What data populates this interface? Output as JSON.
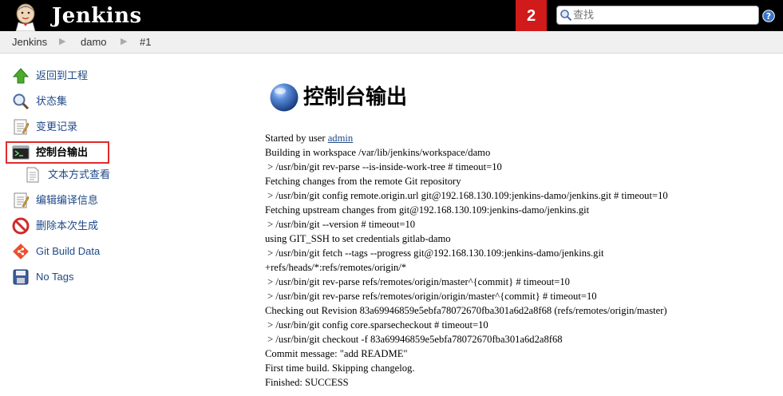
{
  "header": {
    "logo_text": "Jenkins",
    "build_badge": "2",
    "search": {
      "value": "",
      "placeholder": "查找"
    },
    "help_icon": "help-icon"
  },
  "breadcrumbs": [
    "Jenkins",
    "damo",
    "#1"
  ],
  "side_panel": {
    "tasks": [
      {
        "label": "返回到工程",
        "icon": "up-arrow-icon"
      },
      {
        "label": "状态集",
        "icon": "magnifier-icon"
      },
      {
        "label": "变更记录",
        "icon": "notepad-icon"
      },
      {
        "label": "控制台输出",
        "icon": "terminal-icon",
        "selected": true
      },
      {
        "label": "文本方式查看",
        "icon": "document-icon"
      },
      {
        "label": "编辑编译信息",
        "icon": "notepad-icon"
      },
      {
        "label": "删除本次生成",
        "icon": "no-entry-icon"
      },
      {
        "label": "Git Build Data",
        "icon": "git-icon"
      },
      {
        "label": "No Tags",
        "icon": "save-icon"
      }
    ]
  },
  "main": {
    "title": "控制台输出",
    "started_by_prefix": "Started by user ",
    "started_by_user": "admin",
    "console_lines": [
      "Building in workspace /var/lib/jenkins/workspace/damo",
      " > /usr/bin/git rev-parse --is-inside-work-tree # timeout=10",
      "Fetching changes from the remote Git repository",
      " > /usr/bin/git config remote.origin.url git@192.168.130.109:jenkins-damo/jenkins.git # timeout=10",
      "Fetching upstream changes from git@192.168.130.109:jenkins-damo/jenkins.git",
      " > /usr/bin/git --version # timeout=10",
      "using GIT_SSH to set credentials gitlab-damo",
      " > /usr/bin/git fetch --tags --progress git@192.168.130.109:jenkins-damo/jenkins.git",
      "+refs/heads/*:refs/remotes/origin/*",
      " > /usr/bin/git rev-parse refs/remotes/origin/master^{commit} # timeout=10",
      " > /usr/bin/git rev-parse refs/remotes/origin/origin/master^{commit} # timeout=10",
      "Checking out Revision 83a69946859e5ebfa78072670fba301a6d2a8f68 (refs/remotes/origin/master)",
      " > /usr/bin/git config core.sparsecheckout # timeout=10",
      " > /usr/bin/git checkout -f 83a69946859e5ebfa78072670fba301a6d2a8f68",
      "Commit message: \"add README\"",
      "First time build. Skipping changelog.",
      "Finished: SUCCESS"
    ]
  },
  "colors": {
    "header_bg": "#000000",
    "badge": "#d11a1a",
    "link": "#204a87",
    "highlight": "#e22a2a"
  }
}
